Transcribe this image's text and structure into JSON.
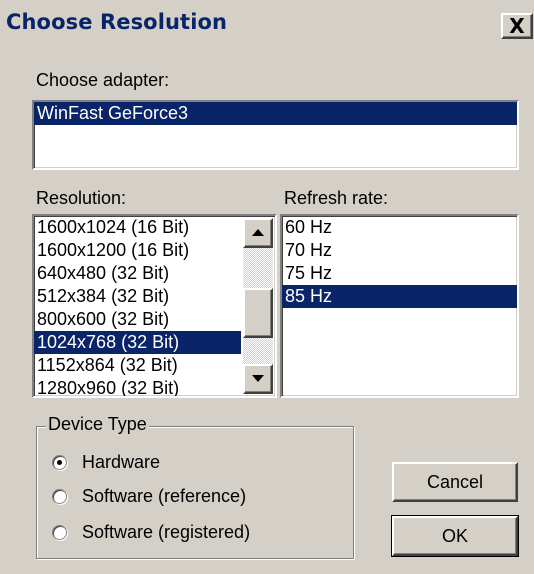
{
  "window": {
    "title": "Choose Resolution",
    "close_label": "X"
  },
  "adapter": {
    "label": "Choose adapter:",
    "items": [
      {
        "label": "WinFast GeForce3",
        "selected": true
      }
    ]
  },
  "resolution": {
    "label": "Resolution:",
    "items": [
      {
        "label": "1600x1024 (16 Bit)",
        "selected": false
      },
      {
        "label": "1600x1200 (16 Bit)",
        "selected": false
      },
      {
        "label": "640x480 (32 Bit)",
        "selected": false
      },
      {
        "label": "512x384 (32 Bit)",
        "selected": false
      },
      {
        "label": "800x600 (32 Bit)",
        "selected": false
      },
      {
        "label": "1024x768 (32 Bit)",
        "selected": true
      },
      {
        "label": "1152x864 (32 Bit)",
        "selected": false
      },
      {
        "label": "1280x960 (32 Bit)",
        "selected": false
      }
    ]
  },
  "refresh": {
    "label": "Refresh rate:",
    "items": [
      {
        "label": "60 Hz",
        "selected": false
      },
      {
        "label": "70 Hz",
        "selected": false
      },
      {
        "label": "75 Hz",
        "selected": false
      },
      {
        "label": "85 Hz",
        "selected": true
      }
    ]
  },
  "device_type": {
    "legend": "Device Type",
    "options": [
      {
        "label": "Hardware",
        "checked": true
      },
      {
        "label": "Software (reference)",
        "checked": false
      },
      {
        "label": "Software (registered)",
        "checked": false
      }
    ]
  },
  "buttons": {
    "cancel": "Cancel",
    "ok": "OK"
  },
  "colors": {
    "face": "#d4d0c8",
    "selection": "#0a246a",
    "title_text": "#0a246a"
  }
}
